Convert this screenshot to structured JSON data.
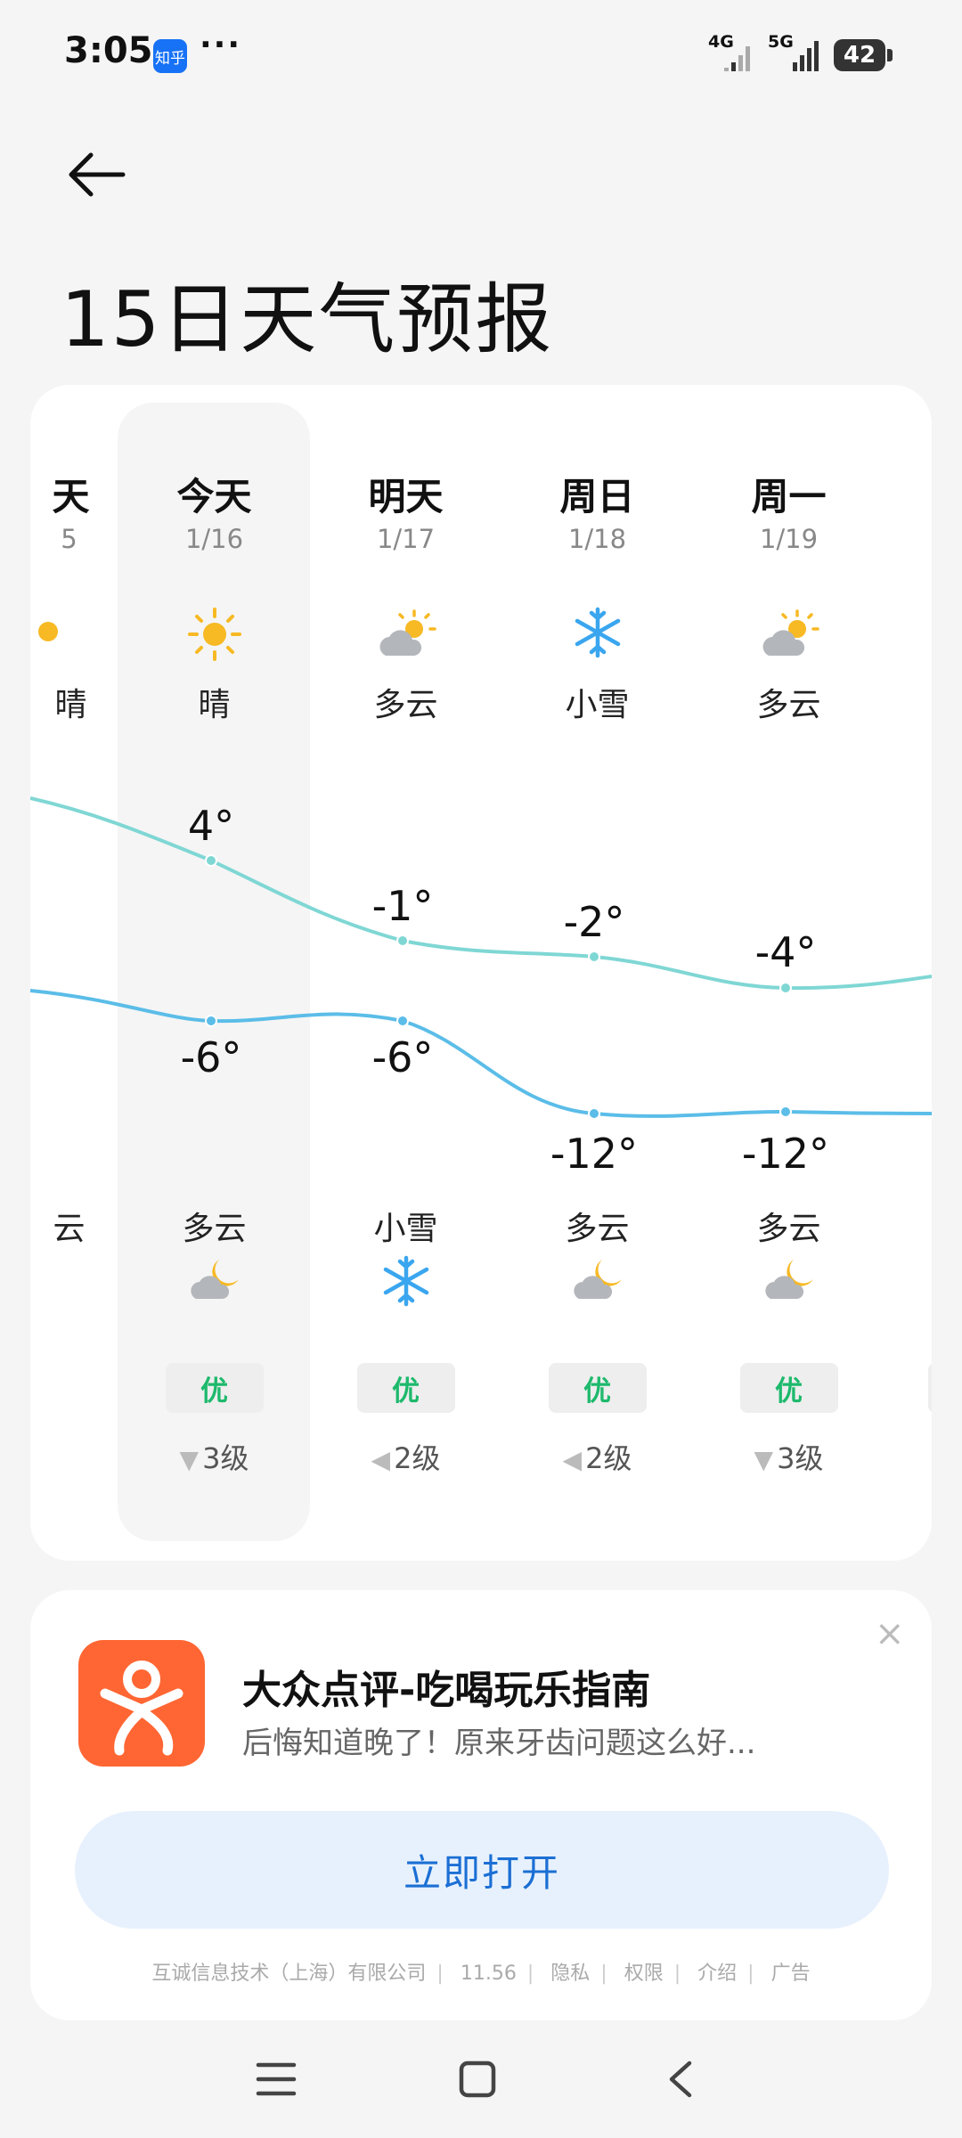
{
  "status": {
    "time": "3:05",
    "app_badge": "知乎",
    "dots": "···",
    "net1": "4G",
    "net2": "5G",
    "battery": "42"
  },
  "page_title": "15日天气预报",
  "forecast": {
    "partial_left": {
      "day": "天",
      "date": "5",
      "day_cond": "晴",
      "night_cond": "云"
    },
    "days": [
      {
        "day": "今天",
        "date": "1/16",
        "day_icon": "sun-icon",
        "day_cond": "晴",
        "high": "4°",
        "low": "-6°",
        "night_cond": "多云",
        "night_icon": "cloud-moon-icon",
        "aqi": "优",
        "wind_dir": "▼",
        "wind": "3级"
      },
      {
        "day": "明天",
        "date": "1/17",
        "day_icon": "sun-cloud-icon",
        "day_cond": "多云",
        "high": "-1°",
        "low": "-6°",
        "night_cond": "小雪",
        "night_icon": "snowflake-icon",
        "aqi": "优",
        "wind_dir": "◀",
        "wind": "2级"
      },
      {
        "day": "周日",
        "date": "1/18",
        "day_icon": "snowflake-icon",
        "day_cond": "小雪",
        "high": "-2°",
        "low": "-12°",
        "night_cond": "多云",
        "night_icon": "cloud-moon-icon",
        "aqi": "优",
        "wind_dir": "◀",
        "wind": "2级"
      },
      {
        "day": "周一",
        "date": "1/19",
        "day_icon": "sun-cloud-icon",
        "day_cond": "多云",
        "high": "-4°",
        "low": "-12°",
        "night_cond": "多云",
        "night_icon": "cloud-moon-icon",
        "aqi": "优",
        "wind_dir": "▼",
        "wind": "3级"
      }
    ],
    "colors": {
      "high_line": "#7fd7d4",
      "low_line": "#5bbde8",
      "aqi_green": "#1db96c",
      "sun": "#f7b924",
      "snow": "#3aa6ef"
    }
  },
  "ad": {
    "title": "大众点评-吃喝玩乐指南",
    "subtitle": "后悔知道晚了！原来牙齿问题这么好...",
    "button": "立即打开",
    "close": "×",
    "footer": [
      "互诚信息技术（上海）有限公司",
      "11.56",
      "隐私",
      "权限",
      "介绍",
      "广告"
    ]
  },
  "nav": {
    "menu_icon": "menu-icon",
    "home_icon": "home-icon",
    "back_icon": "back-icon"
  }
}
